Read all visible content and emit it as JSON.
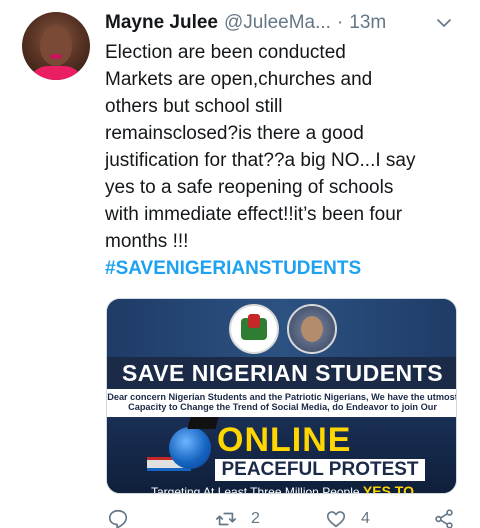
{
  "tweet": {
    "author_name": "Mayne Julee",
    "handle": "@JuleeMa...",
    "separator": "·",
    "time": "13m",
    "body_lines": [
      "Election are been conducted",
      "Markets are open,churches and",
      "others but school still",
      "remainsclosed?is there a good",
      "justification for that??a big NO...I say",
      "yes to a safe reopening of schools",
      "with immediate effect!!it’s been four",
      "months !!!"
    ],
    "hashtag": "#SAVENIGERIANSTUDENTS"
  },
  "media": {
    "title": "SAVE NIGERIAN STUDENTS",
    "subtitle_line1": "Dear concern Nigerian Students and the Patriotic Nigerians, We have the utmost",
    "subtitle_line2": "Capacity to Change the Trend of Social Media, do Endeavor to join Our",
    "online": "ONLINE",
    "peaceful": "PEACEFUL PROTEST",
    "target": "Targeting At Least Three Million People",
    "yes_to": "YES TO"
  },
  "actions": {
    "reply_count": "",
    "retweet_count": "2",
    "like_count": "4"
  },
  "icons": {
    "chevron": "chevron-down-icon",
    "reply": "reply-icon",
    "retweet": "retweet-icon",
    "like": "heart-icon",
    "share": "share-icon"
  },
  "colors": {
    "link": "#1da1f2",
    "secondary_text": "#657786",
    "banner_yellow": "#ffd600"
  }
}
